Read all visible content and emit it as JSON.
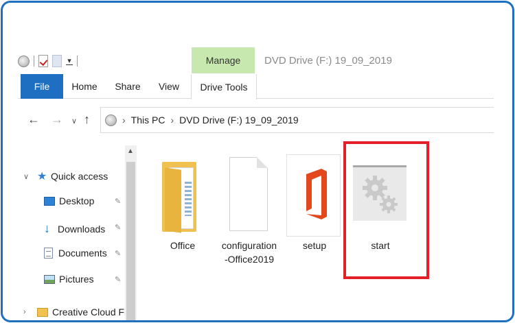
{
  "window": {
    "title": "DVD Drive (F:) 19_09_2019",
    "contextual_tab": "Manage"
  },
  "ribbon": {
    "tabs": [
      {
        "label": "File",
        "active": true
      },
      {
        "label": "Home"
      },
      {
        "label": "Share"
      },
      {
        "label": "View"
      },
      {
        "label": "Drive Tools"
      }
    ]
  },
  "address": {
    "crumbs": [
      "This PC",
      "DVD Drive (F:) 19_09_2019"
    ]
  },
  "nav_pane": {
    "items": [
      {
        "label": "Quick access"
      },
      {
        "label": "Desktop",
        "pinned": true
      },
      {
        "label": "Downloads",
        "pinned": true
      },
      {
        "label": "Documents",
        "pinned": true
      },
      {
        "label": "Pictures",
        "pinned": true
      },
      {
        "label": "Creative Cloud Fil"
      }
    ]
  },
  "files": [
    {
      "name": "Office",
      "type": "folder"
    },
    {
      "name": "configuration\n-Office2019",
      "type": "document"
    },
    {
      "name": "setup",
      "type": "office-app"
    },
    {
      "name": "start",
      "type": "settings-app"
    }
  ],
  "colors": {
    "accent": "#1e6fc2",
    "highlight": "#e32028",
    "manage_tab": "#c7e9b0"
  }
}
